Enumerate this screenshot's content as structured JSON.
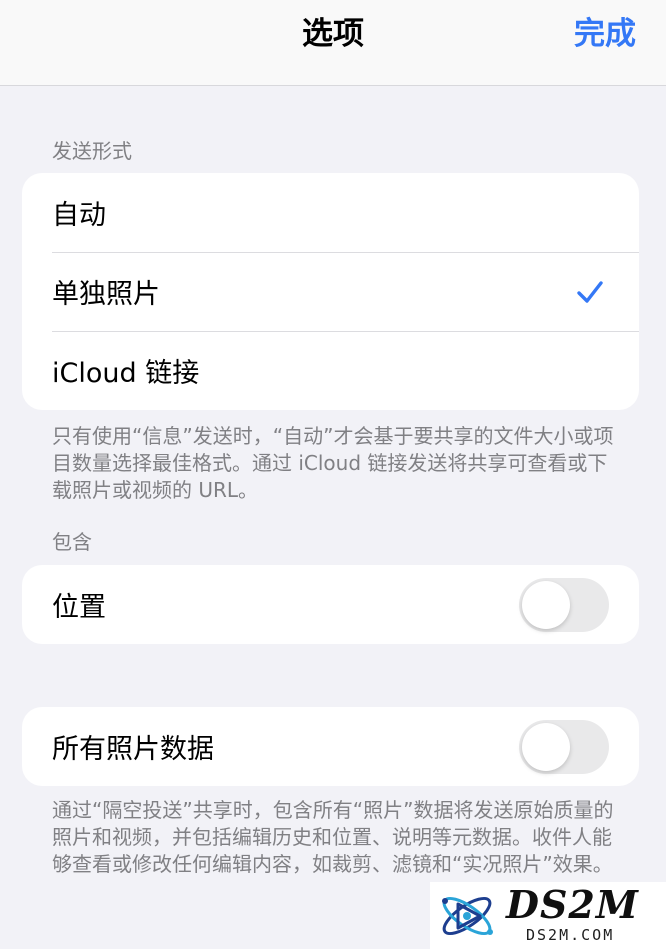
{
  "nav": {
    "title": "选项",
    "done_label": "完成"
  },
  "send_format": {
    "header": "发送形式",
    "options": [
      {
        "label": "自动",
        "selected": false
      },
      {
        "label": "单独照片",
        "selected": true
      },
      {
        "label": "iCloud 链接",
        "selected": false
      }
    ],
    "footer": "只有使用“信息”发送时，“自动”才会基于要共享的文件大小或项目数量选择最佳格式。通过 iCloud 链接发送将共享可查看或下载照片或视频的 URL。"
  },
  "include": {
    "header": "包含",
    "location": {
      "label": "位置",
      "on": false
    }
  },
  "all_photos_data": {
    "label": "所有照片数据",
    "on": false,
    "footer": "通过“隔空投送”共享时，包含所有“照片”数据将发送原始质量的照片和视频，并包括编辑历史和位置、说明等元数据。收件人能够查看或修改任何编辑内容，如裁剪、滤镜和“实况照片”效果。"
  },
  "watermark": {
    "text": "DS2M",
    "subtext": "DS2M.COM"
  },
  "colors": {
    "accent": "#3478f6",
    "background": "#f2f2f7",
    "toggle_off": "#e9e9ea"
  },
  "icons": {
    "check": "checkmark-icon"
  }
}
